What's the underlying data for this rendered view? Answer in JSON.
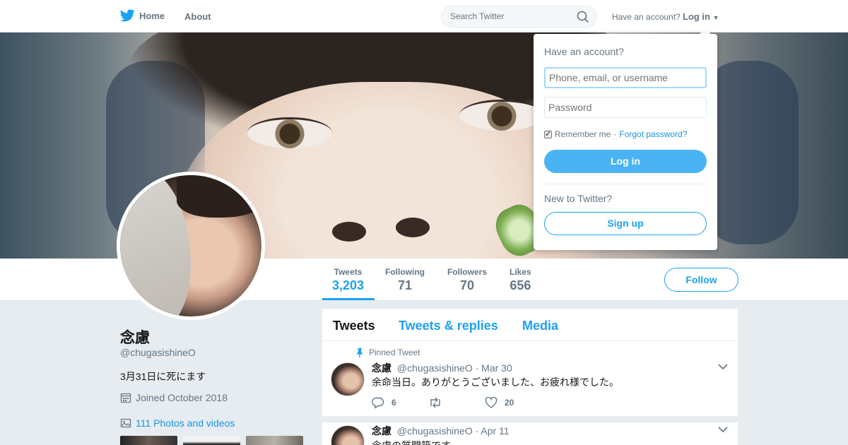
{
  "nav": {
    "home_label": "Home",
    "about_label": "About",
    "search_placeholder": "Search Twitter",
    "have_account": "Have an account?",
    "login_label": "Log in"
  },
  "profile": {
    "name": "念慮",
    "handle": "@chugasishineO",
    "bio": "3月31日に死にます",
    "joined": "Joined October 2018",
    "photos": "111 Photos and videos"
  },
  "stats": [
    {
      "label": "Tweets",
      "value": "3,203"
    },
    {
      "label": "Following",
      "value": "71"
    },
    {
      "label": "Followers",
      "value": "70"
    },
    {
      "label": "Likes",
      "value": "656"
    }
  ],
  "follow_label": "Follow",
  "tabs": [
    "Tweets",
    "Tweets & replies",
    "Media"
  ],
  "tweets": [
    {
      "pinned": "Pinned Tweet",
      "name": "念慮",
      "handle": "@chugasishineO",
      "date": "· Mar 30",
      "text": "余命当日。ありがとうございました、お疲れ様でした。",
      "replies": "6",
      "retweets": "",
      "likes": "20"
    },
    {
      "name": "念慮",
      "handle": "@chugasishineO",
      "date": "· Apr 11",
      "text": "念慮の質問箱です"
    }
  ],
  "login_dropdown": {
    "title": "Have an account?",
    "username_placeholder": "Phone, email, or username",
    "password_placeholder": "Password",
    "remember": "Remember me",
    "forgot": "Forgot password?",
    "login_button": "Log in",
    "new_to": "New to Twitter?",
    "signup_button": "Sign up"
  },
  "colors": {
    "accent": "#1da1f2",
    "login_button": "#4ab3f4",
    "background": "#e6ecf0"
  }
}
